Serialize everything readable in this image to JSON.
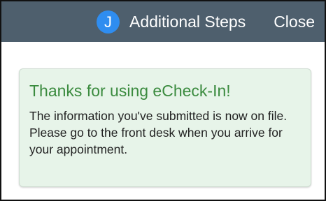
{
  "header": {
    "avatar_initial": "J",
    "title": "Additional Steps",
    "close_label": "Close"
  },
  "message": {
    "title": "Thanks for using eCheck-In!",
    "body": "The information you've submitted is now on file. Please go to the front desk when you arrive for your appointment."
  },
  "colors": {
    "header_background": "#4e5f6d",
    "avatar_background": "#2f8df0",
    "alert_background": "#e7f4e9",
    "alert_title": "#3b8b3f"
  }
}
